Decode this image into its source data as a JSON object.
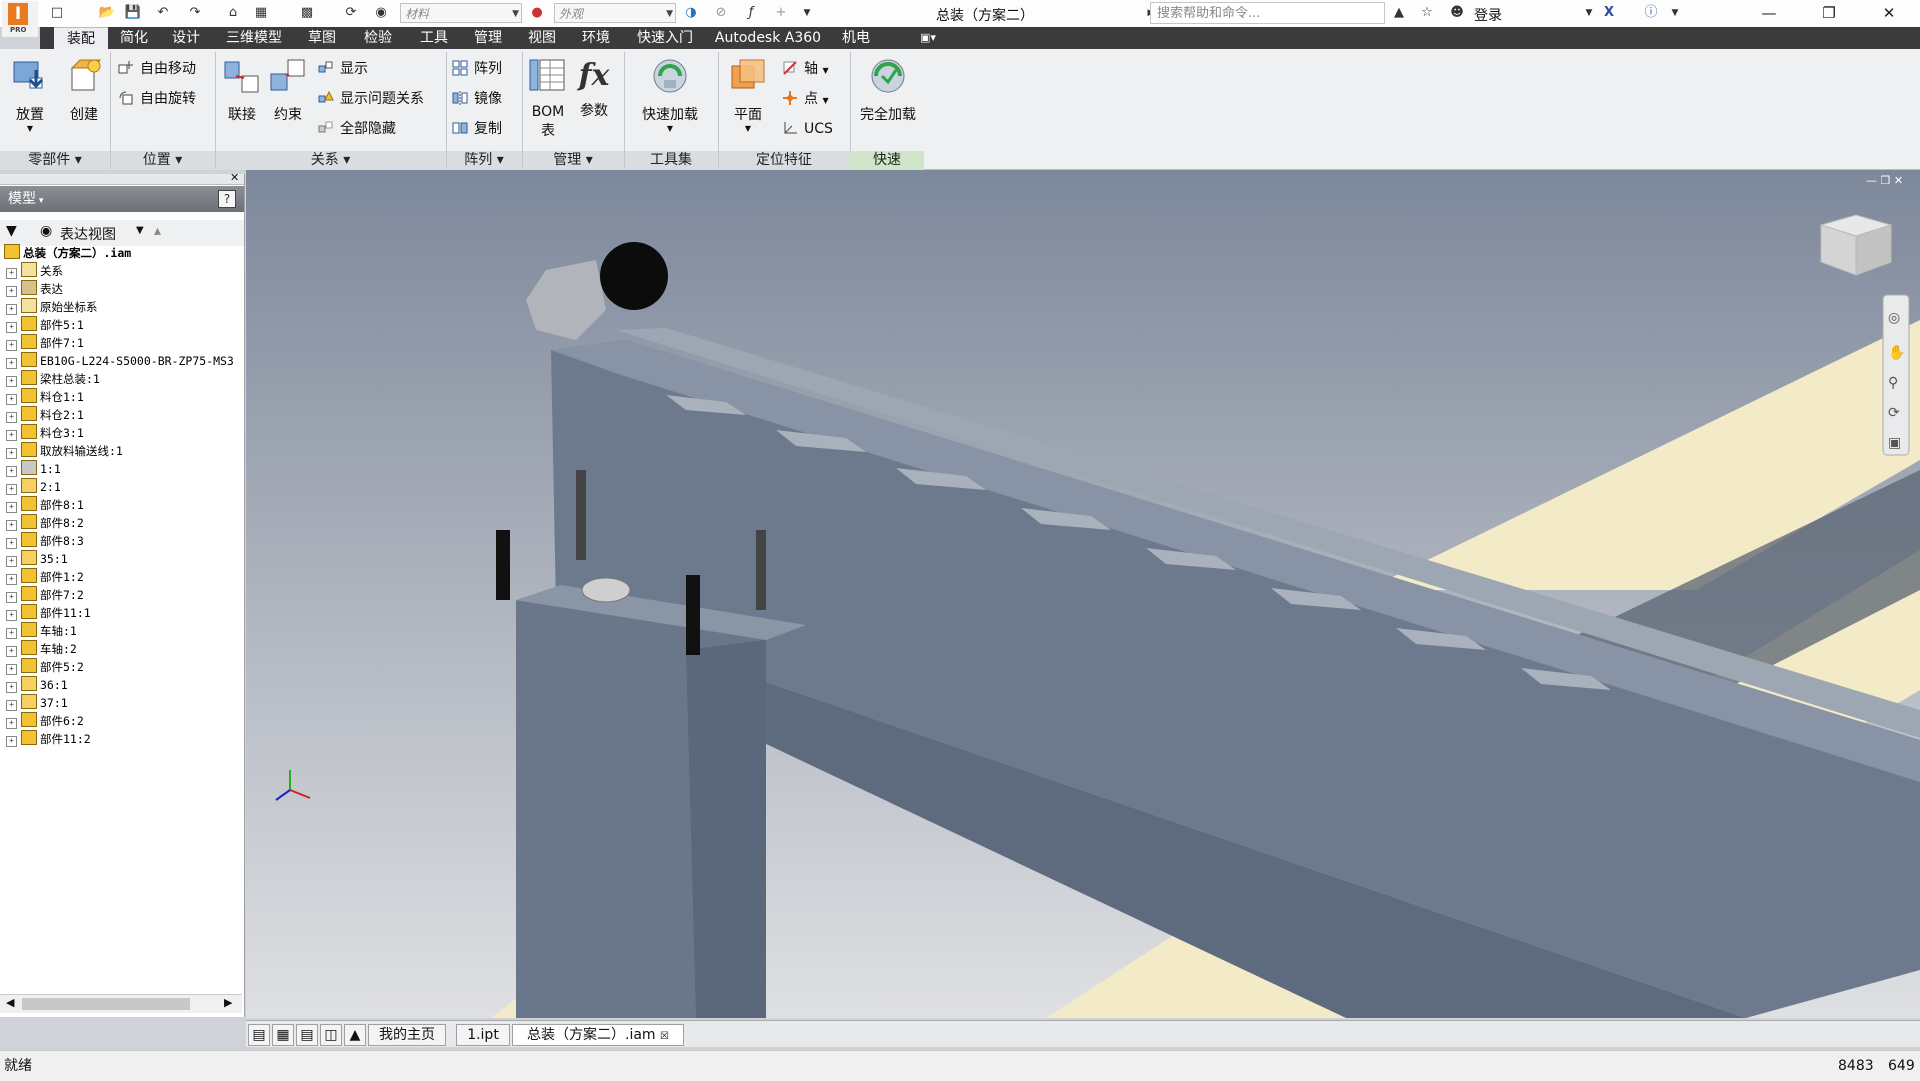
{
  "app": {
    "document_title": "总装（方案二）",
    "product_badge": "PRO"
  },
  "quick_access": {
    "material_placeholder": "材料",
    "appearance_placeholder": "外观",
    "search_placeholder": "搜索帮助和命令...",
    "login": "登录"
  },
  "menu_tabs": [
    "装配",
    "简化",
    "设计",
    "三维模型",
    "草图",
    "检验",
    "工具",
    "管理",
    "视图",
    "环境",
    "快速入门",
    "Autodesk A360",
    "机电"
  ],
  "active_tab": "装配",
  "ribbon": {
    "place": "放置",
    "create": "创建",
    "free_move": "自由移动",
    "free_rotate": "自由旋转",
    "joint": "联接",
    "constrain": "约束",
    "show": "显示",
    "show_problem": "显示问题关系",
    "hide_all": "全部隐藏",
    "pattern": "阵列",
    "mirror": "镜像",
    "copy": "复制",
    "bom": "BOM",
    "bom2": "表",
    "params": "参数",
    "quick_load": "快速加载",
    "plane": "平面",
    "axis": "轴",
    "point": "点",
    "ucs": "UCS",
    "full_load": "完全加载",
    "panels": [
      "零部件",
      "位置",
      "关系",
      "阵列",
      "管理",
      "工具集",
      "定位特征",
      "快速"
    ]
  },
  "browser": {
    "title": "模型",
    "view": "表达视图",
    "items": [
      {
        "label": "总装（方案二）.iam",
        "icon": "assembly-root",
        "top": true
      },
      {
        "label": "关系",
        "icon": "folder"
      },
      {
        "label": "表达",
        "icon": "representation"
      },
      {
        "label": "原始坐标系",
        "icon": "folder"
      },
      {
        "label": "部件5:1",
        "icon": "assembly"
      },
      {
        "label": "部件7:1",
        "icon": "assembly"
      },
      {
        "label": "EB10G-L224-S5000-BR-ZP75-MS3",
        "icon": "assembly"
      },
      {
        "label": "梁柱总装:1",
        "icon": "assembly"
      },
      {
        "label": "料仓1:1",
        "icon": "assembly"
      },
      {
        "label": "料仓2:1",
        "icon": "assembly"
      },
      {
        "label": "料仓3:1",
        "icon": "assembly"
      },
      {
        "label": "取放料输送线:1",
        "icon": "assembly"
      },
      {
        "label": "1:1",
        "icon": "part-gray"
      },
      {
        "label": "2:1",
        "icon": "part"
      },
      {
        "label": "部件8:1",
        "icon": "assembly"
      },
      {
        "label": "部件8:2",
        "icon": "assembly"
      },
      {
        "label": "部件8:3",
        "icon": "assembly"
      },
      {
        "label": "35:1",
        "icon": "part"
      },
      {
        "label": "部件1:2",
        "icon": "assembly"
      },
      {
        "label": "部件7:2",
        "icon": "assembly"
      },
      {
        "label": "部件11:1",
        "icon": "assembly"
      },
      {
        "label": "车轴:1",
        "icon": "assembly"
      },
      {
        "label": "车轴:2",
        "icon": "assembly"
      },
      {
        "label": "部件5:2",
        "icon": "assembly"
      },
      {
        "label": "36:1",
        "icon": "part"
      },
      {
        "label": "37:1",
        "icon": "part"
      },
      {
        "label": "部件6:2",
        "icon": "assembly"
      },
      {
        "label": "部件11:2",
        "icon": "assembly"
      }
    ]
  },
  "doc_tabs": [
    "我的主页",
    "1.ipt",
    "总装（方案二）.iam"
  ],
  "status": {
    "text": "就绪",
    "count1": "8483",
    "count2": "649"
  },
  "colors": {
    "accent": "#e87a20",
    "viewport_top": "#8a94a6",
    "viewport_bottom": "#dcdde0",
    "floor": "#f2e9c6",
    "model": "#6d7a8e"
  }
}
